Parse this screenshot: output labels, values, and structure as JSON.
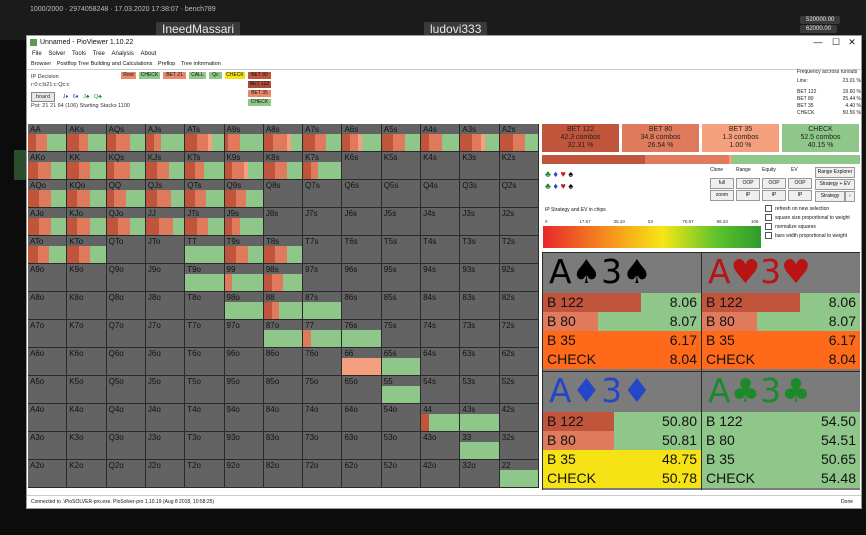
{
  "stream": {
    "top_text": "1000/2000 · 2974058248 · 17.03.2020 17:38:07 · bench789",
    "player_left": "IneedMassari",
    "player_right": "ludovi333",
    "stack1": "520000.00",
    "stack2": "62000.00"
  },
  "window": {
    "title": "Unnamed - PioViewer 1.10.22",
    "minimize": "—",
    "maximize": "☐",
    "close": "✕",
    "menu": [
      "File",
      "Solver",
      "Tools",
      "Tree",
      "Analysis",
      "About"
    ],
    "tabs": [
      "Browser",
      "Postflop Tree Building and Calculations",
      "Preflop",
      "Tree information"
    ]
  },
  "info": {
    "ip_decision": "IP Decision",
    "path": "r:0:c:b21:c:Qc:c",
    "board_btn": "board",
    "board_cards": [
      "J♦",
      "6♦",
      "J♣",
      "Q♣"
    ],
    "pot": "Pot: 21 21 64 (106) Starting Stacks 1100"
  },
  "actions_tree": {
    "row1": [
      "Root",
      "CHECK",
      "BET 21",
      "CALL",
      "Qc",
      "CHECK",
      "BET 80"
    ],
    "row2": [
      "BET 122",
      "BET 35",
      "CHECK"
    ],
    "colors": [
      "#e88a6a",
      "#8fc78a",
      "#e88a6a",
      "#8fc78a",
      "#8fc78a",
      "#f2e016",
      "#c0553c",
      "#a94a36",
      "#e88a6a",
      "#8fc78a"
    ]
  },
  "frequency": {
    "title": "Frequency accross runouts",
    "line_label": "Line:",
    "line_value": "23.01 %",
    "rows": [
      {
        "name": "BET 122",
        "value": "19.60 %"
      },
      {
        "name": "BET 80",
        "value": "25.44 %"
      },
      {
        "name": "BET 35",
        "value": "4.40 %"
      },
      {
        "name": "CHECK",
        "value": "50.56 %"
      }
    ]
  },
  "hand_matrix": {
    "rows": [
      [
        "AA",
        "AKs",
        "AQs",
        "AJs",
        "ATs",
        "A9s",
        "A8s",
        "A7s",
        "A6s",
        "A5s",
        "A4s",
        "A3s",
        "A2s"
      ],
      [
        "AKo",
        "KK",
        "KQs",
        "KJs",
        "KTs",
        "K9s",
        "K8s",
        "K7s",
        "K6s",
        "K5s",
        "K4s",
        "K3s",
        "K2s"
      ],
      [
        "AQo",
        "KQo",
        "QQ",
        "QJs",
        "QTs",
        "Q9s",
        "Q8s",
        "Q7s",
        "Q6s",
        "Q5s",
        "Q4s",
        "Q3s",
        "Q2s"
      ],
      [
        "AJo",
        "KJo",
        "QJo",
        "JJ",
        "JTs",
        "J9s",
        "J8s",
        "J7s",
        "J6s",
        "J5s",
        "J4s",
        "J3s",
        "J2s"
      ],
      [
        "ATo",
        "KTo",
        "QTo",
        "JTo",
        "TT",
        "T9s",
        "T8s",
        "T7s",
        "T6s",
        "T5s",
        "T4s",
        "T3s",
        "T2s"
      ],
      [
        "A9o",
        "K9o",
        "Q9o",
        "J9o",
        "T9o",
        "99",
        "98s",
        "97s",
        "96s",
        "95s",
        "94s",
        "93s",
        "92s"
      ],
      [
        "A8o",
        "K8o",
        "Q8o",
        "J8o",
        "T8o",
        "98o",
        "88",
        "87s",
        "86s",
        "85s",
        "84s",
        "83s",
        "82s"
      ],
      [
        "A7o",
        "K7o",
        "Q7o",
        "J7o",
        "T7o",
        "97o",
        "87o",
        "77",
        "76s",
        "75s",
        "74s",
        "73s",
        "72s"
      ],
      [
        "A6o",
        "K6o",
        "Q6o",
        "J6o",
        "T6o",
        "96o",
        "86o",
        "76o",
        "66",
        "65s",
        "64s",
        "63s",
        "62s"
      ],
      [
        "A5o",
        "K5o",
        "Q5o",
        "J5o",
        "T5o",
        "95o",
        "85o",
        "75o",
        "65o",
        "55",
        "54s",
        "53s",
        "52s"
      ],
      [
        "A4o",
        "K4o",
        "Q4o",
        "J4o",
        "T4o",
        "94o",
        "84o",
        "74o",
        "64o",
        "54o",
        "44",
        "43s",
        "42s"
      ],
      [
        "A3o",
        "K3o",
        "Q3o",
        "J3o",
        "T3o",
        "93o",
        "83o",
        "73o",
        "63o",
        "53o",
        "43o",
        "33",
        "32s"
      ],
      [
        "A2o",
        "K2o",
        "Q2o",
        "J2o",
        "T2o",
        "92o",
        "82o",
        "72o",
        "62o",
        "52o",
        "42o",
        "32o",
        "22"
      ]
    ],
    "filled": {
      "AA": [
        0.2,
        0.3,
        0.0,
        0.5
      ],
      "AKs": [
        0.3,
        0.25,
        0.0,
        0.45
      ],
      "AQs": [
        0.25,
        0.35,
        0.0,
        0.4
      ],
      "AJs": [
        0.2,
        0.2,
        0.0,
        0.6
      ],
      "ATs": [
        0.3,
        0.3,
        0.1,
        0.3
      ],
      "A9s": [
        0.1,
        0.3,
        0.0,
        0.6
      ],
      "A8s": [
        0.25,
        0.35,
        0.1,
        0.3
      ],
      "A7s": [
        0.3,
        0.3,
        0.0,
        0.4
      ],
      "A6s": [
        0.2,
        0.2,
        0.1,
        0.5
      ],
      "A5s": [
        0.3,
        0.3,
        0.0,
        0.4
      ],
      "A4s": [
        0.2,
        0.35,
        0.0,
        0.45
      ],
      "A3s": [
        0.3,
        0.25,
        0.1,
        0.35
      ],
      "A2s": [
        0.35,
        0.3,
        0.0,
        0.35
      ],
      "AKo": [
        0.25,
        0.35,
        0.0,
        0.4
      ],
      "KK": [
        0.3,
        0.3,
        0.0,
        0.4
      ],
      "KQs": [
        0.2,
        0.4,
        0.0,
        0.4
      ],
      "KJs": [
        0.3,
        0.3,
        0.0,
        0.4
      ],
      "KTs": [
        0.25,
        0.25,
        0.0,
        0.5
      ],
      "K9s": [
        0.2,
        0.3,
        0.1,
        0.4
      ],
      "K8s": [
        0.3,
        0.3,
        0.0,
        0.4
      ],
      "K7s": [
        0.2,
        0.2,
        0.0,
        0.6
      ],
      "AQo": [
        0.3,
        0.3,
        0.0,
        0.4
      ],
      "KQo": [
        0.25,
        0.35,
        0.0,
        0.4
      ],
      "QQ": [
        0.2,
        0.3,
        0.0,
        0.5
      ],
      "QJs": [
        0.3,
        0.35,
        0.0,
        0.35
      ],
      "QTs": [
        0.25,
        0.3,
        0.0,
        0.45
      ],
      "Q9s": [
        0.3,
        0.25,
        0.0,
        0.45
      ],
      "AJo": [
        0.3,
        0.3,
        0.0,
        0.4
      ],
      "KJo": [
        0.25,
        0.35,
        0.0,
        0.4
      ],
      "QJo": [
        0.3,
        0.3,
        0.0,
        0.4
      ],
      "JJ": [
        0.35,
        0.35,
        0.0,
        0.3
      ],
      "JTs": [
        0.3,
        0.3,
        0.0,
        0.4
      ],
      "J9s": [
        0.2,
        0.2,
        0.0,
        0.6
      ],
      "ATo": [
        0.25,
        0.3,
        0.0,
        0.45
      ],
      "KTo": [
        0.3,
        0.3,
        0.0,
        0.4
      ],
      "TT": [
        0.0,
        0.0,
        0.0,
        1.0
      ],
      "T9s": [
        0.3,
        0.3,
        0.0,
        0.4
      ],
      "T8s": [
        0.3,
        0.3,
        0.0,
        0.4
      ],
      "T9o": [
        0.0,
        0.0,
        0.0,
        1.0
      ],
      "99": [
        0.0,
        0.2,
        0.0,
        0.8
      ],
      "98s": [
        0.2,
        0.3,
        0.0,
        0.5
      ],
      "98o": [
        0.0,
        0.0,
        0.0,
        1.0
      ],
      "88": [
        0.2,
        0.2,
        0.0,
        0.6
      ],
      "87s": [
        0.0,
        0.0,
        0.0,
        1.0
      ],
      "87o": [
        0.0,
        0.0,
        0.0,
        1.0
      ],
      "77": [
        0.0,
        0.2,
        0.0,
        0.8
      ],
      "76s": [
        0.0,
        0.0,
        0.0,
        1.0
      ],
      "66": [
        0.0,
        0.0,
        1.0,
        0.0
      ],
      "65s": [
        0.0,
        0.0,
        0.0,
        1.0
      ],
      "55": [
        0.0,
        0.0,
        0.0,
        1.0
      ],
      "44": [
        0.2,
        0.0,
        0.0,
        0.8
      ],
      "43s": [
        0.0,
        0.0,
        0.0,
        1.0
      ],
      "33": [
        0.0,
        0.0,
        0.0,
        1.0
      ],
      "22": [
        0.0,
        0.0,
        0.0,
        1.0
      ]
    }
  },
  "strategy_actions": [
    {
      "name": "BET 122",
      "combos": "42.3 combos",
      "pct": "32.31 %",
      "color": "#c0553c"
    },
    {
      "name": "BET 80",
      "combos": "34.8 combos",
      "pct": "26.54 %",
      "color": "#e07a5c"
    },
    {
      "name": "BET 35",
      "combos": "1.3 combos",
      "pct": "1.00 %",
      "color": "#f4a07e"
    },
    {
      "name": "CHECK",
      "combos": "52.5 combos",
      "pct": "40.15 %",
      "color": "#8fc78a"
    }
  ],
  "strategy_split": [
    0.3231,
    0.2654,
    0.01,
    0.4015
  ],
  "controls": {
    "headers": [
      "Clone",
      "Range",
      "Equity",
      "EV"
    ],
    "btn_full": "full",
    "btn_oop": "OOP",
    "btn_ip": "IP",
    "btn_zoom": "zoom",
    "btn_pass": "pass",
    "range_explorer": "Range Explorer",
    "strategy_ev": "Strategy + EV",
    "strategy": "Strategy",
    "arrow": "›"
  },
  "checkboxes": [
    "refresh on new selection",
    "square size proportional to weight",
    "normalize squares",
    "bars width proportional to weight"
  ],
  "gradient": {
    "title": "IP Strategy and EV in chips",
    "ticks": [
      "0",
      "17.67",
      "35.33",
      "53",
      "70.67",
      "88.33",
      "106"
    ]
  },
  "suit_filters": {
    "row1": [
      "♣",
      "♦",
      "♥",
      "♠"
    ],
    "row2": [
      "♣",
      "♦",
      "♥",
      "♠"
    ]
  },
  "combos": [
    {
      "rank1": "A",
      "suit1": "♠",
      "rank2": "3",
      "suit2": "♠",
      "color": "#000000",
      "rows": [
        {
          "name": "B 122",
          "value": "8.06",
          "fill": 0.62,
          "color": "#c0553c"
        },
        {
          "name": "B 80",
          "value": "8.07",
          "fill": 0.35,
          "color": "#e07a5c"
        },
        {
          "name": "B 35",
          "value": "6.17",
          "fill": 1.0,
          "color": "#ff6a1a"
        },
        {
          "name": "CHECK",
          "value": "8.04",
          "fill": 1.0,
          "color": "#ff6a1a"
        }
      ]
    },
    {
      "rank1": "A",
      "suit1": "♥",
      "rank2": "3",
      "suit2": "♥",
      "color": "#b81414",
      "rows": [
        {
          "name": "B 122",
          "value": "8.06",
          "fill": 0.62,
          "color": "#c0553c"
        },
        {
          "name": "B 80",
          "value": "8.07",
          "fill": 0.35,
          "color": "#e07a5c"
        },
        {
          "name": "B 35",
          "value": "6.17",
          "fill": 1.0,
          "color": "#ff6a1a"
        },
        {
          "name": "CHECK",
          "value": "8.04",
          "fill": 1.0,
          "color": "#ff6a1a"
        }
      ]
    },
    {
      "rank1": "A",
      "suit1": "♦",
      "rank2": "3",
      "suit2": "♦",
      "color": "#2447c8",
      "rows": [
        {
          "name": "B 122",
          "value": "50.80",
          "fill": 0.45,
          "color": "#c0553c"
        },
        {
          "name": "B 80",
          "value": "50.81",
          "fill": 0.45,
          "color": "#e07a5c"
        },
        {
          "name": "B 35",
          "value": "48.75",
          "fill": 1.0,
          "color": "#f6e316"
        },
        {
          "name": "CHECK",
          "value": "50.78",
          "fill": 1.0,
          "color": "#f6e316"
        }
      ]
    },
    {
      "rank1": "A",
      "suit1": "♣",
      "rank2": "3",
      "suit2": "♣",
      "color": "#1d8a2a",
      "rows": [
        {
          "name": "B 122",
          "value": "54.50",
          "fill": 0.0,
          "color": "#c0553c"
        },
        {
          "name": "B 80",
          "value": "54.51",
          "fill": 0.0,
          "color": "#e07a5c"
        },
        {
          "name": "B 35",
          "value": "50.65",
          "fill": 0.0,
          "color": "#f6e316"
        },
        {
          "name": "CHECK",
          "value": "54.48",
          "fill": 0.0,
          "color": "#f6e316"
        }
      ]
    }
  ],
  "status": {
    "left": "Connected to .\\PioSOLVER-pro.exe. PioSolver-pro 1.10.19 (Aug 8 2018, 10:58:25)",
    "right": "Done"
  },
  "colors": {
    "bet122": "#c0553c",
    "bet80": "#e07a5c",
    "bet35": "#f4a07e",
    "check": "#8fc78a",
    "empty": "#636363"
  }
}
